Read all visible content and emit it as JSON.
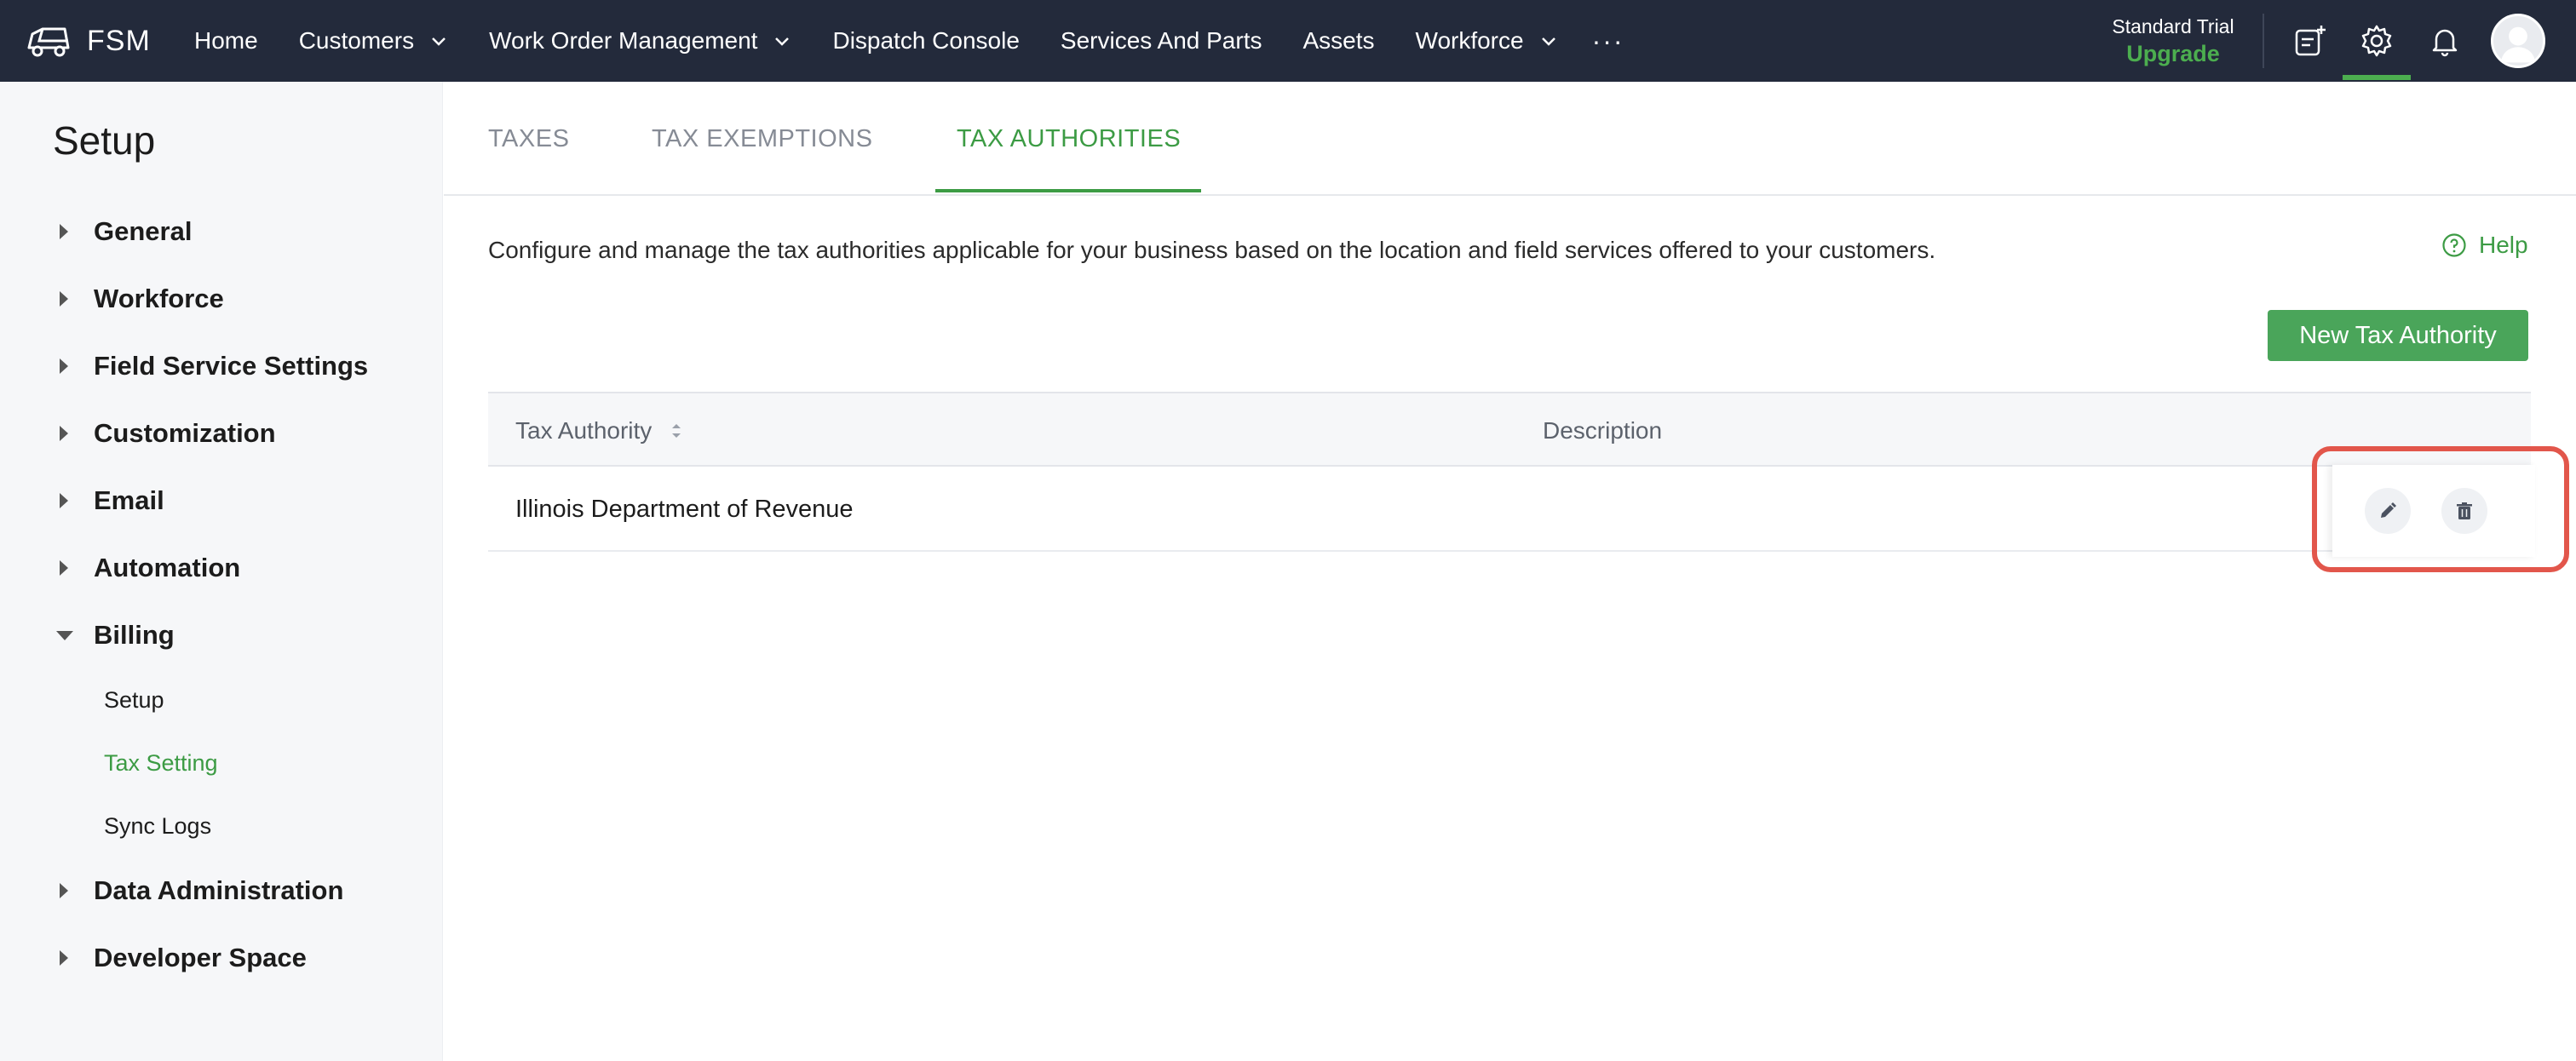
{
  "app": {
    "brand": "FSM",
    "nav": [
      {
        "label": "Home",
        "has_dropdown": false
      },
      {
        "label": "Customers",
        "has_dropdown": true
      },
      {
        "label": "Work Order Management",
        "has_dropdown": true
      },
      {
        "label": "Dispatch Console",
        "has_dropdown": false
      },
      {
        "label": "Services And Parts",
        "has_dropdown": false
      },
      {
        "label": "Assets",
        "has_dropdown": false
      },
      {
        "label": "Workforce",
        "has_dropdown": true
      }
    ],
    "more_label": "···",
    "plan_name": "Standard Trial",
    "plan_action": "Upgrade",
    "icons": [
      "quick-create-icon",
      "gear-icon",
      "bell-icon",
      "avatar"
    ]
  },
  "sidebar": {
    "title": "Setup",
    "items": [
      {
        "label": "General",
        "expanded": false
      },
      {
        "label": "Workforce",
        "expanded": false
      },
      {
        "label": "Field Service Settings",
        "expanded": false
      },
      {
        "label": "Customization",
        "expanded": false
      },
      {
        "label": "Email",
        "expanded": false
      },
      {
        "label": "Automation",
        "expanded": false
      },
      {
        "label": "Billing",
        "expanded": true
      },
      {
        "label": "Data Administration",
        "expanded": false
      },
      {
        "label": "Developer Space",
        "expanded": false
      }
    ],
    "billing_sub": [
      {
        "label": "Setup",
        "active": false
      },
      {
        "label": "Tax Setting",
        "active": true
      },
      {
        "label": "Sync Logs",
        "active": false
      }
    ]
  },
  "tabs": [
    {
      "label": "TAXES",
      "active": false
    },
    {
      "label": "TAX EXEMPTIONS",
      "active": false
    },
    {
      "label": "TAX AUTHORITIES",
      "active": true
    }
  ],
  "description": "Configure and manage the tax authorities applicable for your business based on the location and field services offered to your customers.",
  "help_label": "Help",
  "new_button": "New Tax Authority",
  "table": {
    "columns": [
      "Tax Authority",
      "Description"
    ],
    "rows": [
      {
        "tax_authority": "Illinois Department of Revenue",
        "description": ""
      }
    ]
  },
  "colors": {
    "topbar": "#232a3b",
    "accent": "#3c9b44",
    "button": "#4aa55a",
    "highlight": "#e2564b"
  }
}
